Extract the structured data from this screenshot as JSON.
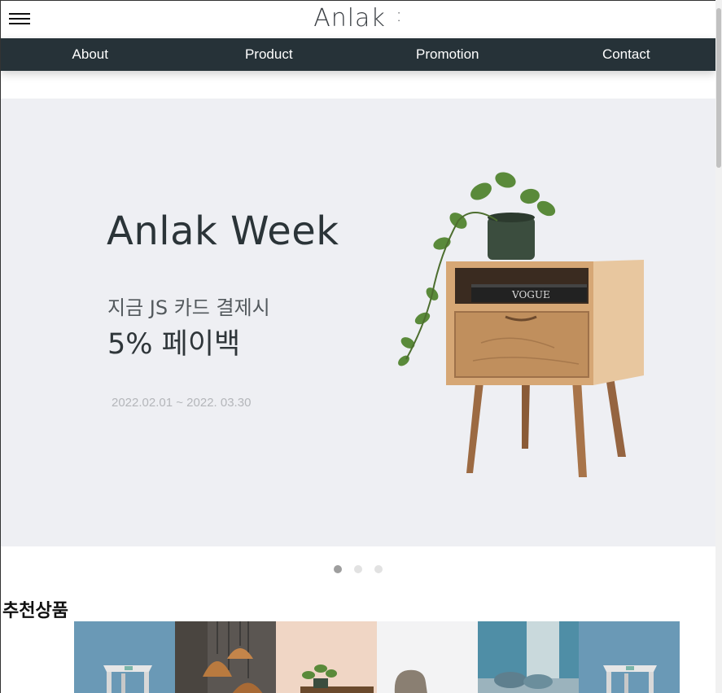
{
  "header": {
    "brand": "Anlak",
    "brand_mark": ":",
    "menu_icon": "hamburger-menu-icon"
  },
  "nav": {
    "items": [
      {
        "label": "About"
      },
      {
        "label": "Product"
      },
      {
        "label": "Promotion"
      },
      {
        "label": "Contact"
      }
    ],
    "background": "#263238"
  },
  "hero": {
    "title": "Anlak Week",
    "line1": "지금 JS 카드 결제시",
    "line2": "5% 페이백",
    "period": "2022.02.01 ~ 2022. 03.30",
    "image": "nightstand-with-plant-image",
    "background": "#eeeff3"
  },
  "carousel": {
    "slide_count": 3,
    "active_index": 0
  },
  "recommended": {
    "title": "추천상품",
    "products": [
      {
        "image": "stool-product-image"
      },
      {
        "image": "pendant-lamp-product-image"
      },
      {
        "image": "nightstand-plant-product-image"
      },
      {
        "image": "chair-product-image"
      },
      {
        "image": "sofa-product-image"
      },
      {
        "image": "stool-product-image"
      }
    ]
  }
}
